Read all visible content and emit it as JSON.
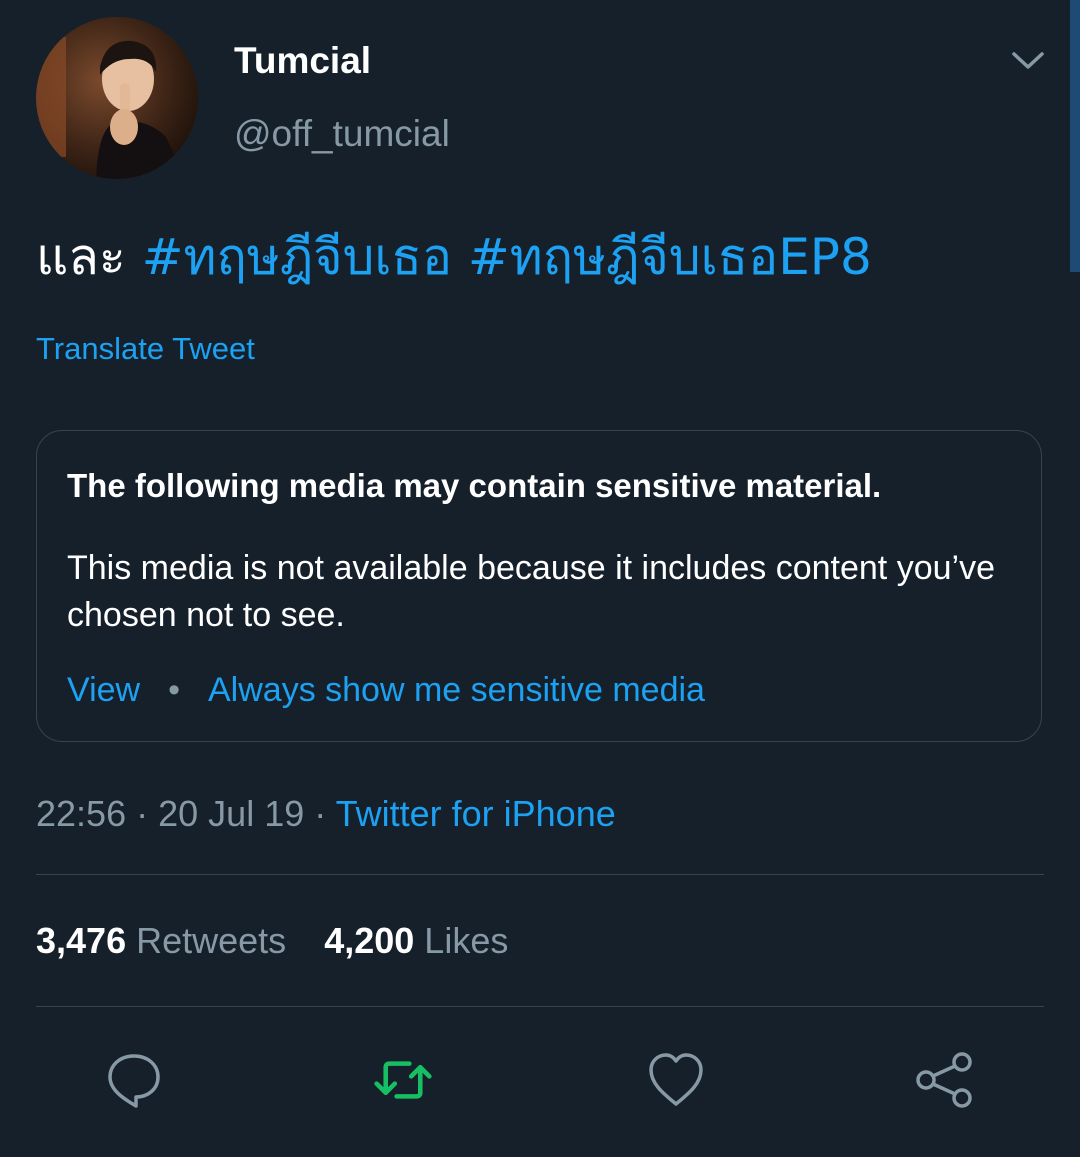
{
  "author": {
    "display_name": "Tumcial",
    "handle": "@off_tumcial"
  },
  "tweet": {
    "text_prefix": "และ",
    "hashtags": [
      "#ทฤษฎีจีบเธอ",
      "#ทฤษฎีจีบเธอEP8"
    ],
    "translate_label": "Translate Tweet"
  },
  "sensitive_media": {
    "title": "The following media may contain sensitive material.",
    "body": "This media is not available because it includes content you’ve chosen not to see.",
    "view_label": "View",
    "separator": "•",
    "always_show_label": "Always show me sensitive media"
  },
  "meta": {
    "time": "22:56",
    "dot": "·",
    "date": "20 Jul 19",
    "source": "Twitter for iPhone"
  },
  "stats": {
    "retweets_count": "3,476",
    "retweets_label": "Retweets",
    "likes_count": "4,200",
    "likes_label": "Likes"
  },
  "actions": {
    "reply_icon": "speech-bubble-icon",
    "retweet_icon": "retweet-arrows-icon",
    "like_icon": "heart-icon",
    "share_icon": "share-nodes-icon"
  },
  "colors": {
    "background": "#15202b",
    "accent": "#1da1f2",
    "muted": "#8899a6",
    "retweet_active": "#17bf63",
    "border": "#38444d"
  }
}
